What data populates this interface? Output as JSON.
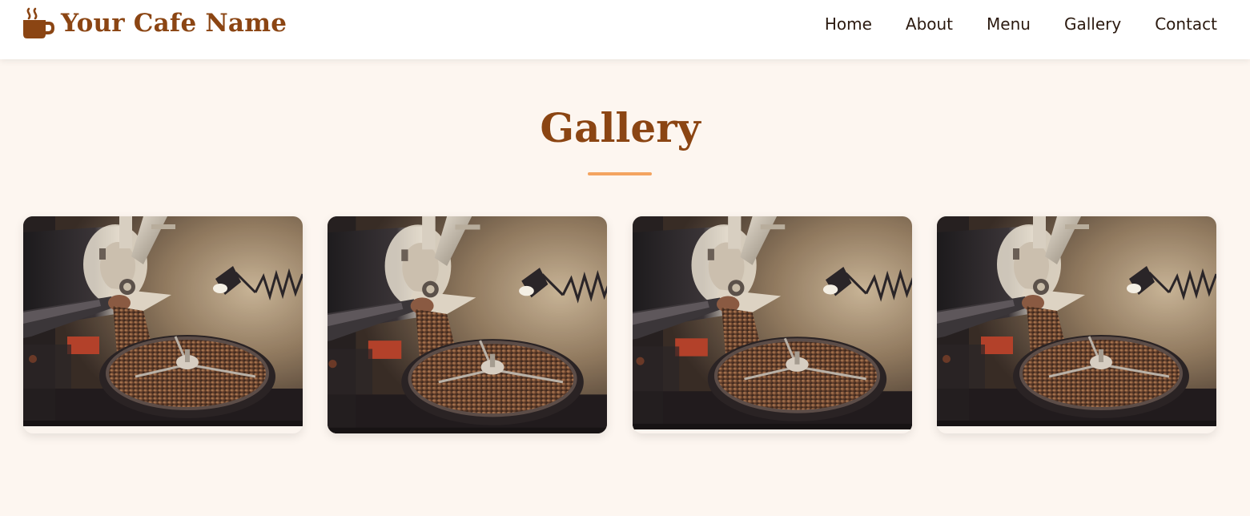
{
  "header": {
    "brand_name": "Your Cafe Name",
    "brand_icon": "coffee-cup-icon",
    "nav": [
      {
        "label": "Home"
      },
      {
        "label": "About"
      },
      {
        "label": "Menu"
      },
      {
        "label": "Gallery"
      },
      {
        "label": "Contact"
      }
    ]
  },
  "gallery": {
    "title": "Gallery",
    "items": [
      {
        "image": "coffee-roaster-photo"
      },
      {
        "image": "coffee-roaster-photo"
      },
      {
        "image": "coffee-roaster-photo"
      },
      {
        "image": "coffee-roaster-photo"
      }
    ]
  },
  "colors": {
    "brand": "#8b4513",
    "accent": "#f4a460",
    "page_background": "#fdf6f0",
    "header_background": "#ffffff",
    "nav_text": "#2b1a10"
  }
}
